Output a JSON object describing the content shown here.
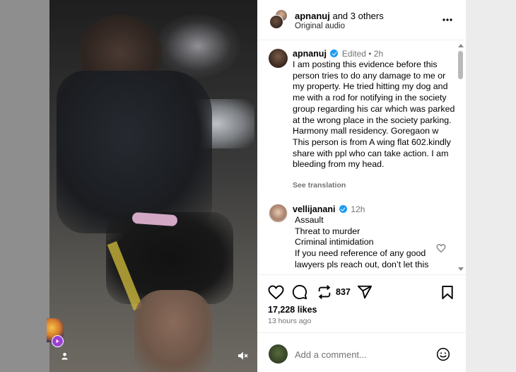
{
  "post": {
    "header": {
      "username": "apnanuj",
      "collab_text": "and 3 others",
      "audio": "Original audio"
    },
    "caption": {
      "username": "apnanuj",
      "meta": "Edited • 2h",
      "text": "I am posting this evidence before this person tries to do any damage to me or my property.  He tried hitting my dog and me with a rod for notifying in the society group regarding his car which was parked at the wrong place in the society parking. Harmony mall residency. Goregaon w  This person is from A wing flat 602.kindly share with ppl who can take action. I am bleeding from my head.",
      "see_translation": "See translation"
    },
    "comments": [
      {
        "username": "vellijanani",
        "time": "12h",
        "lines": [
          "Assault",
          "Threat to murder",
          "Criminal intimidation",
          "If you need reference of any good lawyers pls reach out, don’t let this"
        ]
      }
    ],
    "actions": {
      "share_count": "837",
      "likes": "17,228 likes",
      "time_ago": "13 hours ago"
    },
    "add_comment": {
      "placeholder": "Add a comment..."
    }
  },
  "icons": {
    "header": [
      "collab-avatar-stack",
      "more-options-icon"
    ],
    "actions": [
      "heart-icon",
      "comment-icon",
      "repost-icon",
      "share-icon",
      "save-icon"
    ],
    "video": [
      "mute-icon",
      "collab-badge-icon",
      "person-icon"
    ],
    "comment": [
      "like-comment-icon"
    ],
    "input": [
      "emoji-icon"
    ]
  },
  "colors": {
    "verified": "#1d9bf0",
    "muted_text": "#737373",
    "collab_badge": "#9b3fd6"
  }
}
